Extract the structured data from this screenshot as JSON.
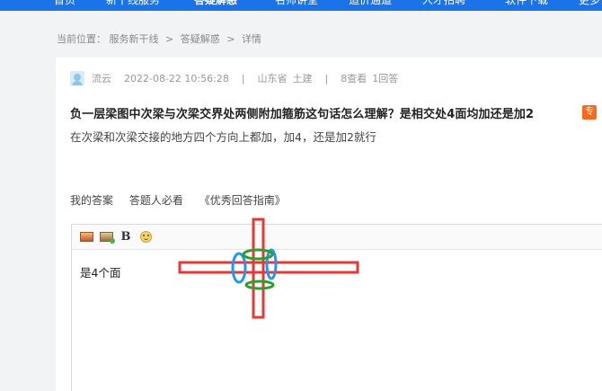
{
  "breadcrumb": {
    "prefix": "当前位置：",
    "items": [
      "服务新干线",
      "答疑解惑",
      "详情"
    ],
    "separator": ">"
  },
  "question": {
    "author": "流云",
    "datetime": "2022-08-22 10:56:28",
    "location": "山东省",
    "category": "土建",
    "views": "8查看",
    "answers": "1回答",
    "title": "负一层梁图中次梁与次梁交界处两侧附加箍筋这句话怎么理解？是相交处4面均加还是加2",
    "badge": "专",
    "body": "在次梁和次梁交接的地方四个方向上都加，加4，还是加2就行"
  },
  "answer_tabs": [
    "我的答案",
    "答题人必看",
    "《优秀回答指南》"
  ],
  "editor": {
    "content": "是4个面",
    "tools": [
      "image-icon",
      "image-add-icon",
      "bold-icon",
      "emoji-icon"
    ],
    "bold_label": "B"
  },
  "colors": {
    "nav": "#1a73e8",
    "badge": "#f56a1e",
    "annotation_red": "#e53935",
    "annotation_blue": "#2196f3",
    "annotation_green": "#2e9e2e"
  }
}
